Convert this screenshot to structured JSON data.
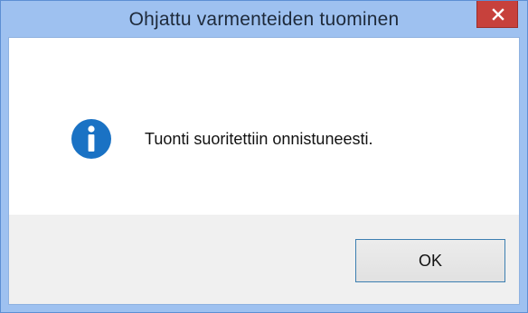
{
  "window": {
    "title": "Ohjattu varmenteiden tuominen",
    "close_icon": "close-icon"
  },
  "dialog": {
    "icon": "info-icon",
    "message": "Tuonti suoritettiin onnistuneesti."
  },
  "buttons": {
    "ok_label": "OK"
  },
  "colors": {
    "titlebar": "#9ec1f0",
    "close_button": "#c7413c",
    "info_icon": "#1a72c4",
    "footer": "#f0f0f0",
    "ok_border": "#3c7fb1"
  }
}
